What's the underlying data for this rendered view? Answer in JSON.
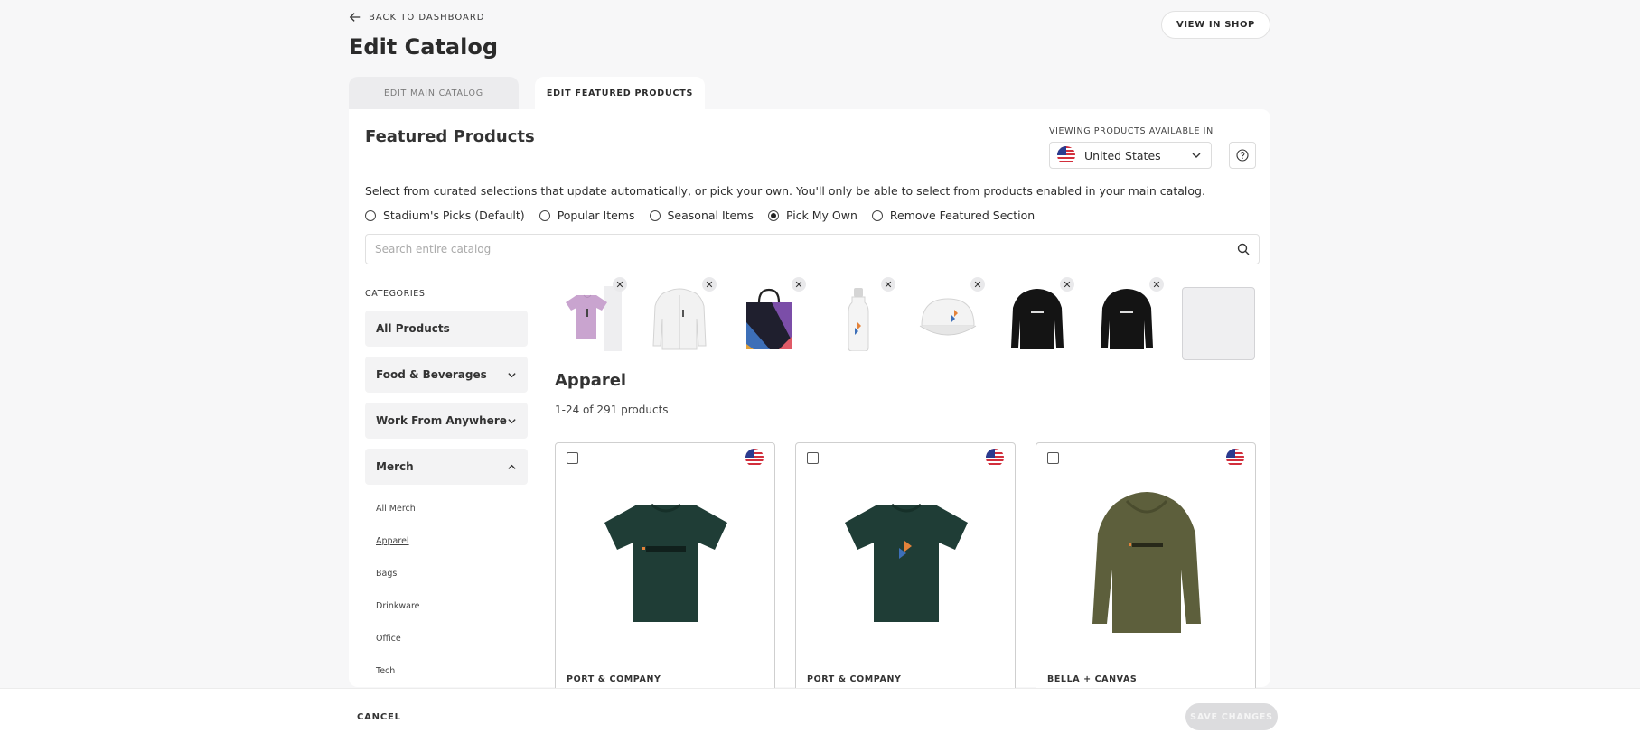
{
  "header": {
    "back_label": "BACK TO DASHBOARD",
    "title": "Edit Catalog",
    "view_shop_label": "VIEW IN SHOP"
  },
  "tabs": [
    {
      "label": "EDIT MAIN CATALOG",
      "active": false
    },
    {
      "label": "EDIT FEATURED PRODUCTS",
      "active": true
    }
  ],
  "featured": {
    "title": "Featured Products",
    "viewing_label": "VIEWING PRODUCTS AVAILABLE IN",
    "country": "United States",
    "description": "Select from curated selections that update automatically, or pick your own. You'll only be able to select from products enabled in your main catalog.",
    "options": [
      {
        "label": "Stadium's Picks (Default)",
        "checked": false
      },
      {
        "label": "Popular Items",
        "checked": false
      },
      {
        "label": "Seasonal Items",
        "checked": false
      },
      {
        "label": "Pick My Own",
        "checked": true
      },
      {
        "label": "Remove Featured Section",
        "checked": false
      }
    ],
    "search_placeholder": "Search entire catalog",
    "remove_glyph": "✕",
    "selected_items": [
      {
        "icon": "lavender-tshirt-icon"
      },
      {
        "icon": "white-zip-hoodie-icon"
      },
      {
        "icon": "tote-bag-icon"
      },
      {
        "icon": "water-bottle-icon"
      },
      {
        "icon": "white-cap-icon"
      },
      {
        "icon": "black-hoodie-icon"
      },
      {
        "icon": "black-hoodie-icon"
      }
    ]
  },
  "categories": {
    "label": "CATEGORIES",
    "items": [
      {
        "label": "All Products"
      },
      {
        "label": "Food & Beverages",
        "expanded": false
      },
      {
        "label": "Work From Anywhere",
        "expanded": false
      },
      {
        "label": "Merch",
        "expanded": true
      }
    ],
    "merch_sub": [
      "All Merch",
      "Apparel",
      "Bags",
      "Drinkware",
      "Office",
      "Tech"
    ],
    "current_sub": "Apparel"
  },
  "listing": {
    "heading": "Apparel",
    "count": "1-24 of 291 products",
    "products": [
      {
        "brand": "PORT & COMPANY",
        "image": "green-tshirt-stadium-text",
        "color": "#1f3d36"
      },
      {
        "brand": "PORT & COMPANY",
        "image": "green-tshirt-stadium-logo",
        "color": "#1f3d36"
      },
      {
        "brand": "BELLA + CANVAS",
        "image": "olive-hoodie-stadium-text",
        "color": "#5d5f3c"
      }
    ]
  },
  "footer": {
    "cancel_label": "CANCEL",
    "save_label": "SAVE CHANGES"
  },
  "colors": {
    "accent": "#2b2b2b",
    "panel_bg": "#ffffff",
    "page_bg": "#f7f7f8",
    "disabled_btn": "#dcdcde"
  }
}
